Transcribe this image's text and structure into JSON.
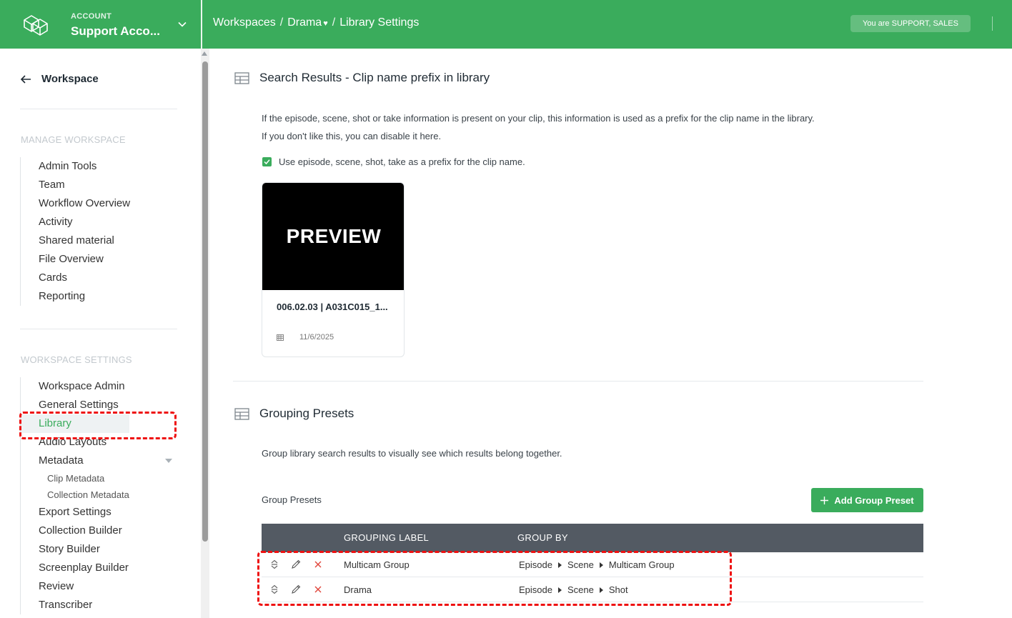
{
  "topbar": {
    "account_label": "ACCOUNT",
    "account_name": "Support Acco...",
    "breadcrumbs": [
      "Workspaces",
      "Drama",
      "Library Settings"
    ],
    "heart": "♥",
    "separator": "/",
    "role_badge": "You are SUPPORT, SALES",
    "icons": {
      "logo": "cube-logo-icon",
      "chevron": "chevron-down-icon"
    }
  },
  "sidebar": {
    "back_label": "Workspace",
    "manage_title": "MANAGE WORKSPACE",
    "manage_items": [
      "Admin Tools",
      "Team",
      "Workflow Overview",
      "Activity",
      "Shared material",
      "File Overview",
      "Cards",
      "Reporting"
    ],
    "settings_title": "WORKSPACE SETTINGS",
    "settings_items": [
      "Workspace Admin",
      "General Settings",
      "Library",
      "Audio Layouts",
      "Metadata"
    ],
    "metadata_sub": [
      "Clip Metadata",
      "Collection Metadata"
    ],
    "more_items": [
      "Export Settings",
      "Collection Builder",
      "Story Builder",
      "Screenplay Builder",
      "Review",
      "Transcriber"
    ],
    "active_item": "Library"
  },
  "search_results": {
    "title": "Search Results - Clip name prefix in library",
    "desc1": "If the episode, scene, shot or take information is present on your clip, this information is used as a prefix for the clip name in the library.",
    "desc2": "If you don't like this, you can disable it here.",
    "checkbox_label": "Use episode, scene, shot, take as a prefix for the clip name.",
    "checkbox_checked": true,
    "preview": {
      "image_text": "PREVIEW",
      "title": "006.02.03 | A031C015_1...",
      "date": "11/6/2025"
    }
  },
  "grouping": {
    "title": "Grouping Presets",
    "desc": "Group library search results to visually see which results belong together.",
    "presets_label": "Group Presets",
    "add_button": "Add Group Preset",
    "columns": [
      "GROUPING LABEL",
      "GROUP BY"
    ],
    "rows": [
      {
        "label": "Multicam Group",
        "group_by": [
          "Episode",
          "Scene",
          "Multicam Group"
        ]
      },
      {
        "label": "Drama",
        "group_by": [
          "Episode",
          "Scene",
          "Shot"
        ]
      }
    ]
  },
  "colors": {
    "brand_green": "#3aac5c",
    "table_header": "#535a63",
    "highlight": "#e11111"
  }
}
